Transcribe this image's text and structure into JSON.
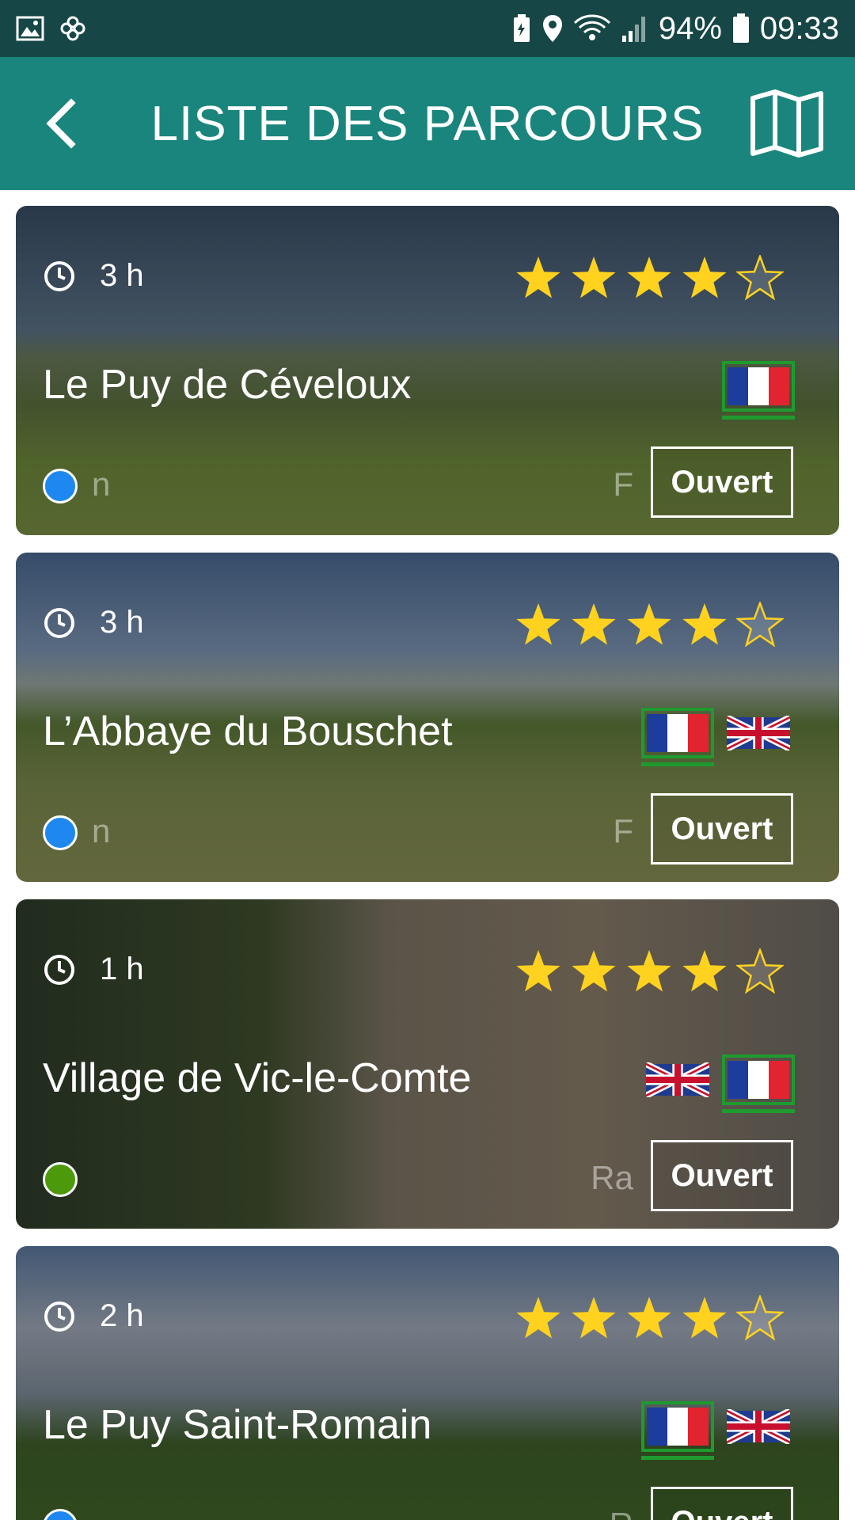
{
  "status_bar": {
    "battery": "94%",
    "time": "09:33",
    "icons": [
      "image-icon",
      "pinwheel-icon",
      "battery-saver-icon",
      "location-icon",
      "wifi-icon",
      "signal-icon",
      "battery-icon"
    ]
  },
  "app_bar": {
    "title": "LISTE DES PARCOURS",
    "back_icon": "chevron-left-icon",
    "map_icon": "map-icon"
  },
  "colors": {
    "status_bar_bg": "#164646",
    "app_bar_bg": "#1a857c",
    "star": "#ffd21f",
    "dot_blue": "#1e88f0",
    "dot_green": "#4c9a0b",
    "flag_selected": "#1f9a2f"
  },
  "routes": [
    {
      "duration": "3 h",
      "rating": 4,
      "max_rating": 5,
      "name": "Le Puy de Céveloux",
      "flags": [
        {
          "lang": "fr",
          "selected": true
        }
      ],
      "dot_color": "blue",
      "faded_left": "n",
      "faded_right": "F",
      "button": "Ouvert"
    },
    {
      "duration": "3 h",
      "rating": 4,
      "max_rating": 5,
      "name": "L’Abbaye du Bouschet",
      "flags": [
        {
          "lang": "fr",
          "selected": true
        },
        {
          "lang": "en",
          "selected": false
        }
      ],
      "dot_color": "blue",
      "faded_left": "n",
      "faded_right": "F",
      "button": "Ouvert"
    },
    {
      "duration": "1 h",
      "rating": 4,
      "max_rating": 5,
      "name": "Village de Vic-le-Comte",
      "flags": [
        {
          "lang": "en",
          "selected": false
        },
        {
          "lang": "fr",
          "selected": true
        }
      ],
      "dot_color": "green",
      "faded_left": "",
      "faded_right": "Ra",
      "button": "Ouvert"
    },
    {
      "duration": "2 h",
      "rating": 4,
      "max_rating": 5,
      "name": "Le Puy Saint-Romain",
      "flags": [
        {
          "lang": "fr",
          "selected": true
        },
        {
          "lang": "en",
          "selected": false
        }
      ],
      "dot_color": "blue",
      "faded_left": "",
      "faded_right": "R",
      "button": "Ouvert"
    }
  ]
}
